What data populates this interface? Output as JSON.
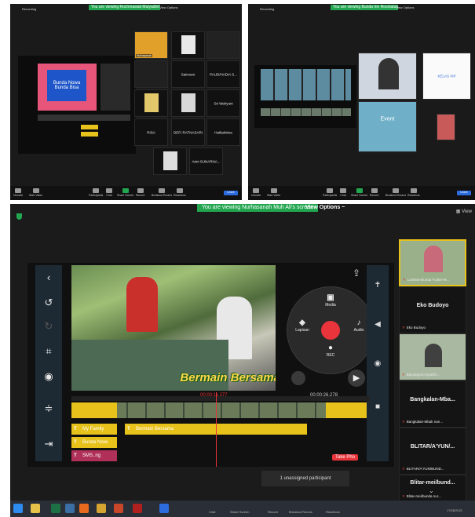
{
  "colors": {
    "green": "#23a650",
    "red": "#e8343a",
    "yellow": "#e7c21a",
    "blue": "#2d6cdf",
    "bg": "#1b1b1b"
  },
  "panel_a": {
    "recording": "Recording",
    "banner": "You are viewing Rochmawati Mulyadini's screen",
    "view_options": "View Options",
    "tiles": [
      "Saimoen",
      "PAUD/HADIA S...",
      "Sri Wahyuni",
      "RISA",
      "DEFI RATNASARI",
      "Haifashima",
      "Arini SUNARNA..."
    ],
    "slide_title": "Bunda Nowa Bunda Bisa",
    "controls": [
      "Unmute",
      "Start Video",
      "Participants",
      "Chat",
      "Share Screen",
      "Record",
      "Breakout Rooms",
      "Reactions"
    ],
    "leave": "Leave"
  },
  "panel_b": {
    "recording": "Recording",
    "banner": "You are viewing Bunda Inn Rosniatun's screen",
    "view_options": "View Options",
    "tiles": [
      "KELAS VIP",
      "Event"
    ],
    "controls": [
      "Unmute",
      "Start Video",
      "Participants",
      "Chat",
      "Share Screen",
      "Record",
      "Breakout Rooms",
      "Reactions"
    ],
    "leave": "Leave"
  },
  "main": {
    "banner": "You are viewing Nurhasanah Muh Ali's screen",
    "view_options": "View Options ~",
    "view": "View",
    "editor": {
      "overlay_text": "Bermain Bersama",
      "time_current": "00:00:11.277",
      "time_end": "00:00:26.278",
      "wheel": {
        "media": "Media",
        "audio": "Audio",
        "layer": "Lapisan",
        "rec": "REC"
      },
      "layers": [
        "My Family",
        "Bermain Bersama",
        "Bunda Nowi",
        "SMS..ng"
      ],
      "take_photo": "Take Pho"
    },
    "participants": [
      {
        "big": "",
        "sub": "Lumbok-Bunda Fuster-M..."
      },
      {
        "big": "Eko Budoyo",
        "sub": "Eko Budoyo"
      },
      {
        "big": "",
        "sub": "Bojonegoro-Syarifi /..."
      },
      {
        "big": "Bangkalan-Mba...",
        "sub": "Bangkalan-Mbak nan..."
      },
      {
        "big": "BLITAR/A'YUN/...",
        "sub": "BLITAR/A'YUN/BUND..."
      },
      {
        "big": "Blitar-mei/bund...",
        "sub": "Blitar-mei/bunda nur..."
      }
    ],
    "unassigned": "1 unassigned participant",
    "taskbar_labels": [
      "Chat",
      "Share Screen",
      "Record",
      "Breakout Rooms",
      "Reactions"
    ],
    "clock": "17/08/2021"
  }
}
